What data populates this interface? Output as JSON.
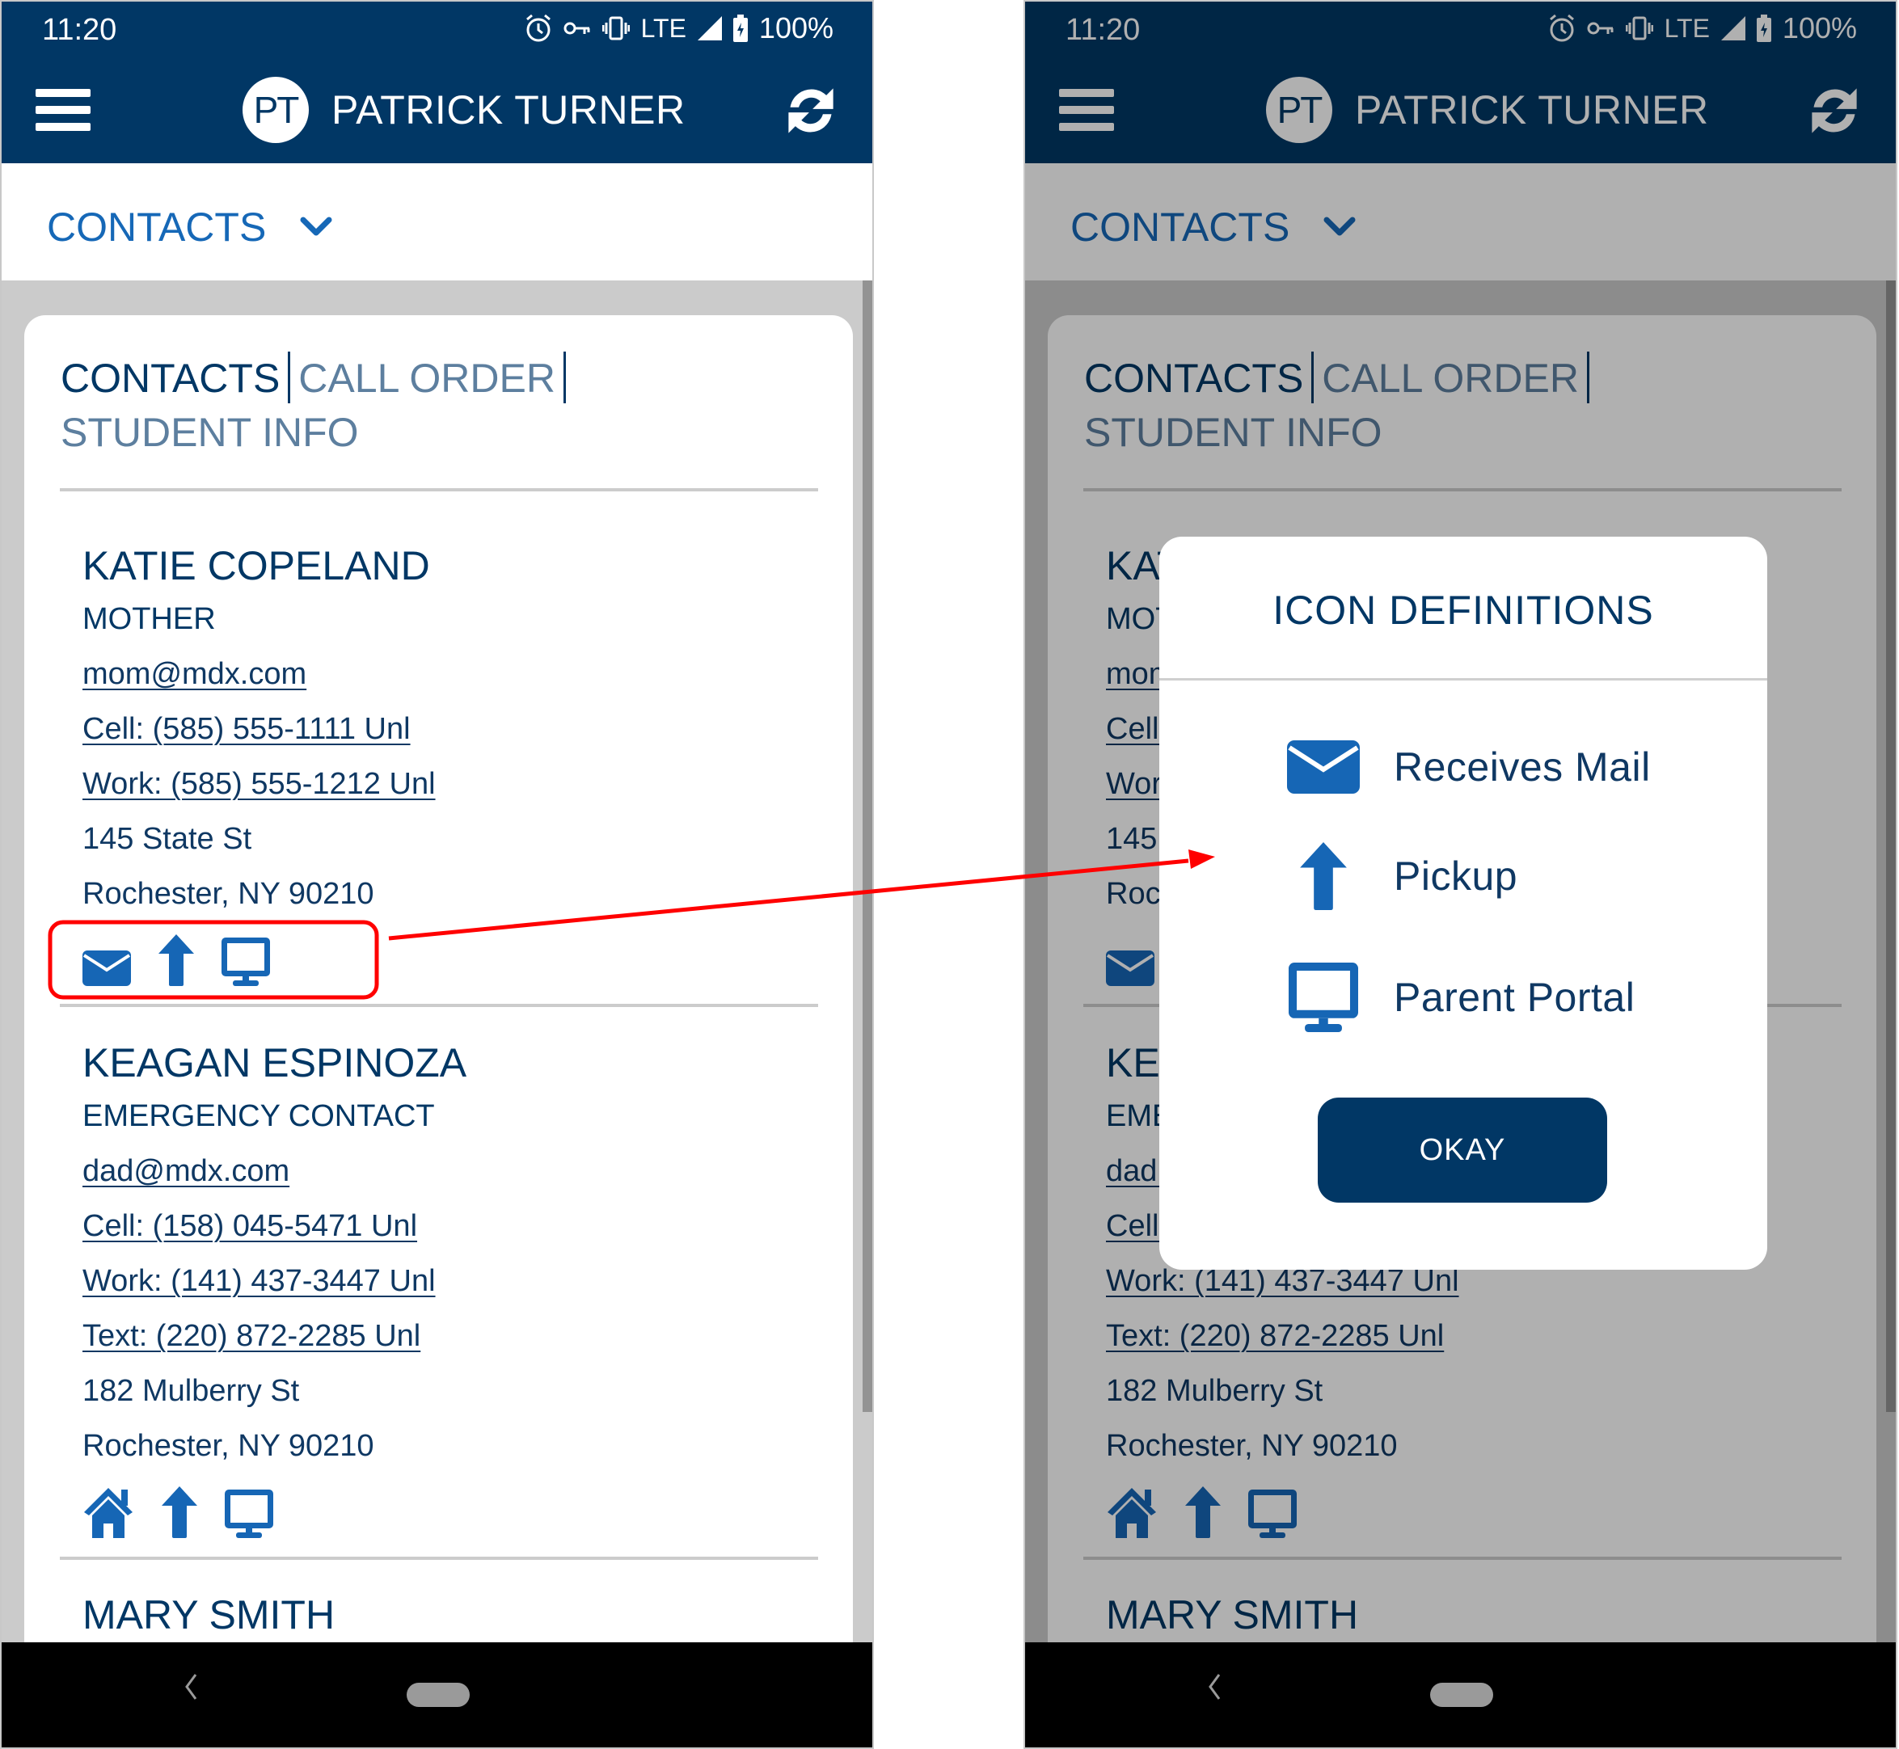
{
  "colors": {
    "navy": "#013765",
    "accent_blue": "#1668b7",
    "icon_blue": "#1666b5",
    "tab_inactive": "#5d7f9f",
    "annotation_red": "#ff0000"
  },
  "status_bar": {
    "time": "11:20",
    "icons": [
      "alarm-icon",
      "vpn-key-icon",
      "vibrate-icon",
      "lte-signal-icon",
      "battery-charging-icon"
    ],
    "network": "LTE",
    "battery": "100%"
  },
  "header": {
    "avatar_initials": "PT",
    "user_name": "PATRICK TURNER",
    "menu_icon": "hamburger-menu-icon",
    "refresh_icon": "refresh-icon"
  },
  "section_dropdown": {
    "label": "CONTACTS",
    "icon": "chevron-down-icon"
  },
  "tabs": [
    {
      "label": "CONTACTS",
      "active": true
    },
    {
      "label": "CALL ORDER",
      "active": false
    },
    {
      "label": "STUDENT INFO",
      "active": false
    }
  ],
  "contacts": [
    {
      "name": "KATIE COPELAND",
      "role": "MOTHER",
      "email": "mom@mdx.com",
      "phones": [
        "Cell: (585) 555-1111 Unl",
        "Work: (585) 555-1212 Unl"
      ],
      "address_line1": "145 State St",
      "address_line2": "Rochester, NY 90210",
      "icons": [
        "mail-icon",
        "pickup-arrow-icon",
        "parent-portal-monitor-icon"
      ]
    },
    {
      "name": "KEAGAN ESPINOZA",
      "role": "EMERGENCY CONTACT",
      "email": "dad@mdx.com",
      "phones": [
        "Cell: (158) 045-5471 Unl",
        "Work: (141) 437-3447 Unl",
        "Text: (220) 872-2285 Unl"
      ],
      "address_line1": "182 Mulberry St",
      "address_line2": "Rochester, NY 90210",
      "icons": [
        "home-icon",
        "pickup-arrow-icon",
        "parent-portal-monitor-icon"
      ]
    },
    {
      "name": "MARY SMITH"
    }
  ],
  "dialog": {
    "title": "ICON DEFINITIONS",
    "definitions": [
      {
        "icon": "mail-icon",
        "label": "Receives Mail"
      },
      {
        "icon": "pickup-arrow-icon",
        "label": "Pickup"
      },
      {
        "icon": "parent-portal-monitor-icon",
        "label": "Parent Portal"
      }
    ],
    "button_label": "OKAY"
  },
  "nav_bar": {
    "back_icon": "back-chevron-icon",
    "home_icon": "home-pill-icon"
  }
}
